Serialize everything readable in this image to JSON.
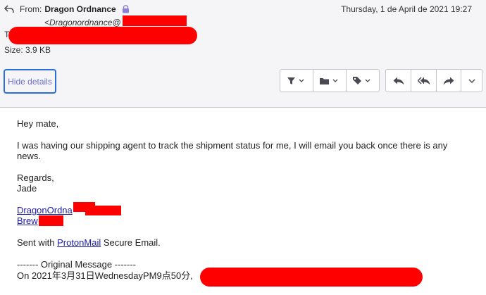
{
  "header": {
    "from_prefix": "From:",
    "from_name": "Dragon Ordnance",
    "sender_email": "<Dragonordnance@",
    "date": "Thursday, 1 de April de 2021 19:27",
    "to_prefix": "T",
    "size_label": "Size: 3.9 KB",
    "hide_details_label": "Hide details"
  },
  "toolbar": {
    "filter_icon": "filter-icon",
    "folder_icon": "folder-icon",
    "label_icon": "tag-icon",
    "reply_icon": "reply-icon",
    "reply_all_icon": "reply-all-icon",
    "forward_icon": "forward-icon",
    "more_icon": "chevron-down-icon"
  },
  "message": {
    "greeting": "Hey mate,",
    "paragraph_line1": "I was having our shipping agent to track the shipment status for me, I will email you back once there is any",
    "paragraph_line2": "news.",
    "regards": "Regards,",
    "signer": "Jade",
    "link1_visible": "DragonOrdna",
    "link2_visible": "Brew",
    "sent_with_prefix": "Sent with ",
    "sent_with_link": "ProtonMail",
    "sent_with_suffix": " Secure Email.",
    "original_header": "------- Original Message -------",
    "original_date": "On 2021年3月31日WednesdayPM9点50分,"
  },
  "colors": {
    "redaction": "#ff0000",
    "link": "#1a1aa6",
    "focus_border": "#2a6fd8",
    "header_bg": "#f5f5f7"
  }
}
